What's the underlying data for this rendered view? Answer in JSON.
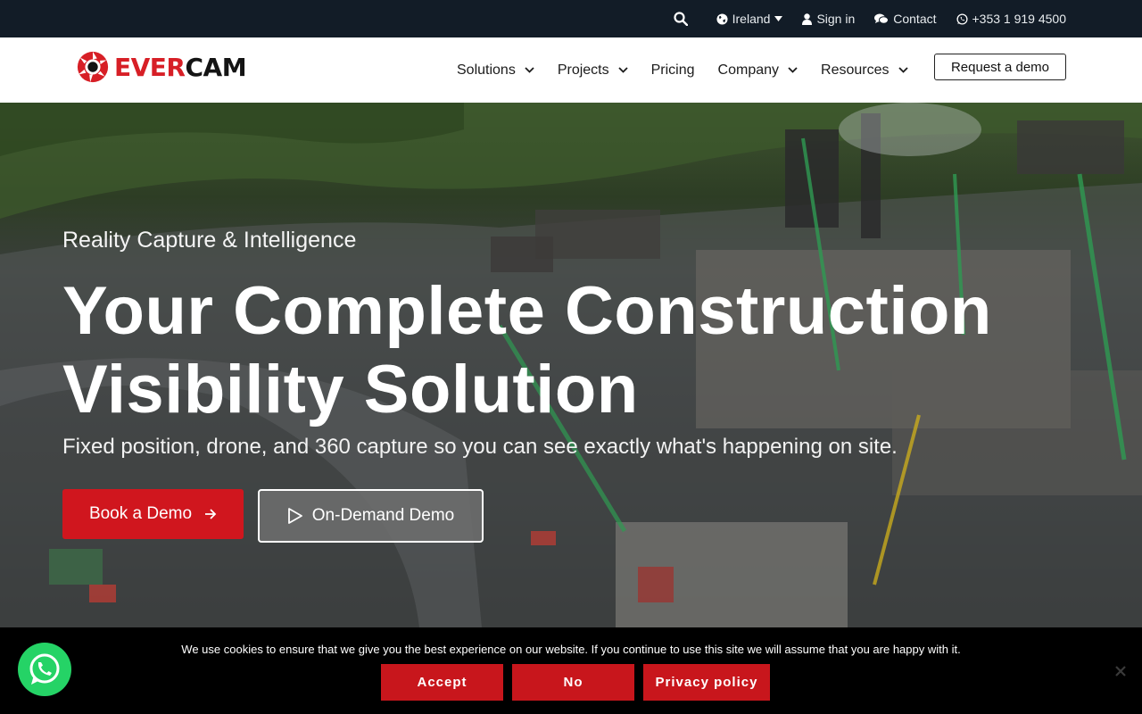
{
  "topbar": {
    "region_label": "Ireland",
    "signin_label": "Sign in",
    "contact_label": "Contact",
    "phone_label": "+353 1 919 4500"
  },
  "logo": {
    "part1": "EVER",
    "part2": "CAM"
  },
  "nav": {
    "items": [
      {
        "label": "Solutions"
      },
      {
        "label": "Projects"
      },
      {
        "label": "Pricing"
      },
      {
        "label": "Company"
      },
      {
        "label": "Resources"
      }
    ],
    "request_demo_label": "Request a demo"
  },
  "hero": {
    "eyebrow": "Reality Capture & Intelligence",
    "title_line1": "Your Complete Construction",
    "title_line2": "Visibility Solution",
    "subtitle": "Fixed position, drone, and 360 capture so you can see exactly what's happening on site.",
    "book_demo_label": "Book a Demo",
    "ondemand_label": "On-Demand Demo"
  },
  "cookie": {
    "message": "We use cookies to ensure that we give you the best experience on our website. If you continue to use this site we will assume that you are happy with it.",
    "accept_label": "Accept",
    "no_label": "No",
    "privacy_label": "Privacy policy"
  },
  "colors": {
    "brand_red": "#d0161e",
    "topbar_bg": "#121c27",
    "whatsapp_green": "#25d366"
  }
}
